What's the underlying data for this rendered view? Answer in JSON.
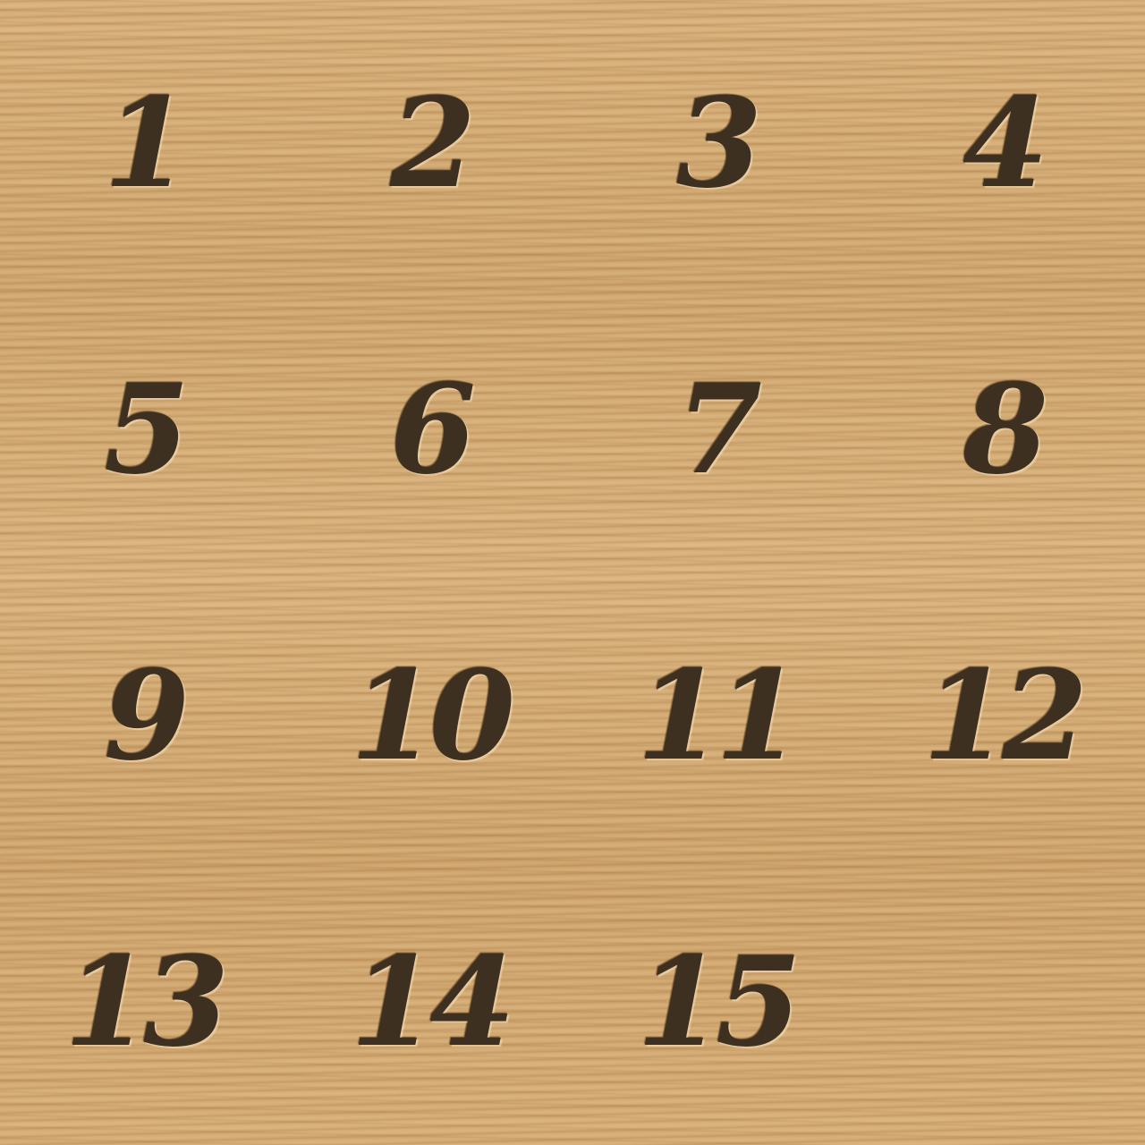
{
  "puzzle": {
    "tiles": [
      "1",
      "2",
      "3",
      "4",
      "5",
      "6",
      "7",
      "8",
      "9",
      "10",
      "11",
      "12",
      "13",
      "14",
      "15",
      ""
    ]
  },
  "colors": {
    "wood": "#d4aa72",
    "engraving": "#3e3020"
  }
}
